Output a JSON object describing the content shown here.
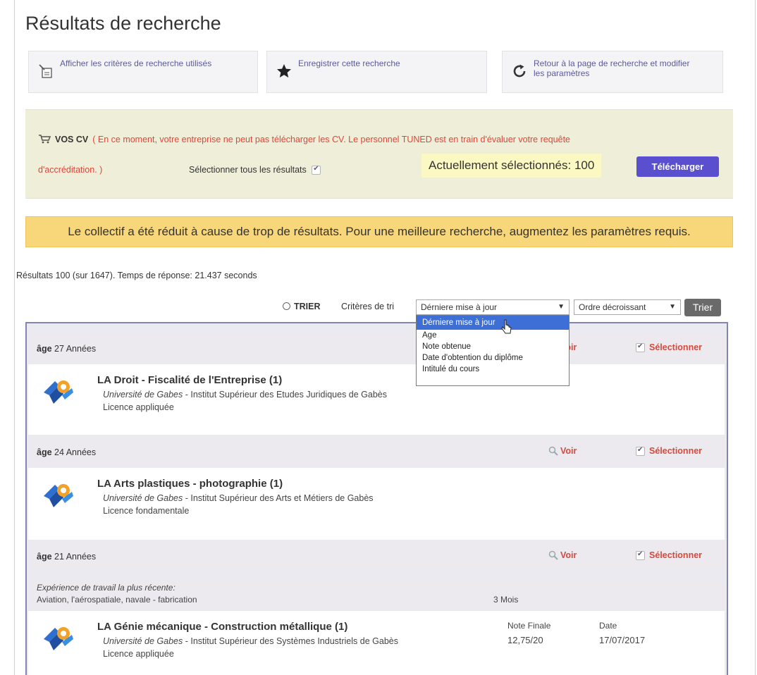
{
  "page": {
    "title": "Résultats de recherche"
  },
  "actions": [
    {
      "label": "Afficher les critères de recherche utilisés",
      "icon": "criteria-doc-icon"
    },
    {
      "label": "Enregistrer cette recherche",
      "icon": "star-icon"
    },
    {
      "label": "Retour à la page de recherche et modifier les paramètres",
      "icon": "refresh-icon"
    }
  ],
  "cv_panel": {
    "heading": "VOS CV",
    "message": "( En ce moment, votre entreprise ne peut pas télécharger les CV. Le personnel TUNED est en train d'évaluer votre requête",
    "message_end": "d'accréditation. )",
    "select_all_label": "Sélectionner tous les résultats",
    "current_selected": "Actuellement sélectionnés: 100",
    "download_button": "Télécharger"
  },
  "warning": "Le collectif a été réduit à cause de trop de résultats. Pour une meilleure recherche, augmentez les paramètres requis.",
  "results_summary": "Résultats 100 (sur 1647).  Temps de réponse: 21.437 seconds",
  "sort": {
    "toggle_label": "TRIER",
    "criteria_label": "Critères de tri",
    "criteria_selected": "Dérniere mise à jour",
    "criteria_options": [
      "Dérniere mise à jour",
      "Age",
      "Note obtenue",
      "Date d'obtention du diplôme",
      "Intitulé du cours"
    ],
    "order_selected": "Ordre décroissant",
    "button": "Trier"
  },
  "common": {
    "age_prefix": "âge",
    "view_label": "Voir",
    "select_label": "Sélectionner"
  },
  "candidates": [
    {
      "age": "27 Années",
      "course": "LA Droit - Fiscalité de l'Entreprise (1)",
      "university": "Université de Gabes",
      "institute": " - Institut Supérieur des Etudes Juridiques de Gabès",
      "degree": "Licence appliquée"
    },
    {
      "age": "24 Années",
      "course": "LA Arts plastiques - photographie (1)",
      "university": "Université de Gabes",
      "institute": " - Institut Supérieur des Arts et Métiers de Gabès",
      "degree": "Licence fondamentale"
    },
    {
      "age": "21 Années",
      "experience_label": "Expérience de travail la plus récente:",
      "experience": "Aviation, l'aérospatiale, navale - fabrication",
      "experience_duration": "3 Mois",
      "course": "LA Génie mécanique - Construction métallique (1)",
      "university": "Université de Gabes",
      "institute": " - Institut Supérieur des Systèmes Industriels de Gabès",
      "degree": "Licence appliquée",
      "grade_label": "Note Finale",
      "grade": "12,75/20",
      "date_label": "Date",
      "date": "17/07/2017"
    }
  ],
  "colors": {
    "accent_button": "#5a4fcf",
    "warning_bg": "#f8d77a",
    "panel_bg": "#efeed8",
    "alert_text": "#e0453a",
    "select_text": "#d5493d",
    "dropdown_highlight": "#3d6fd6"
  }
}
